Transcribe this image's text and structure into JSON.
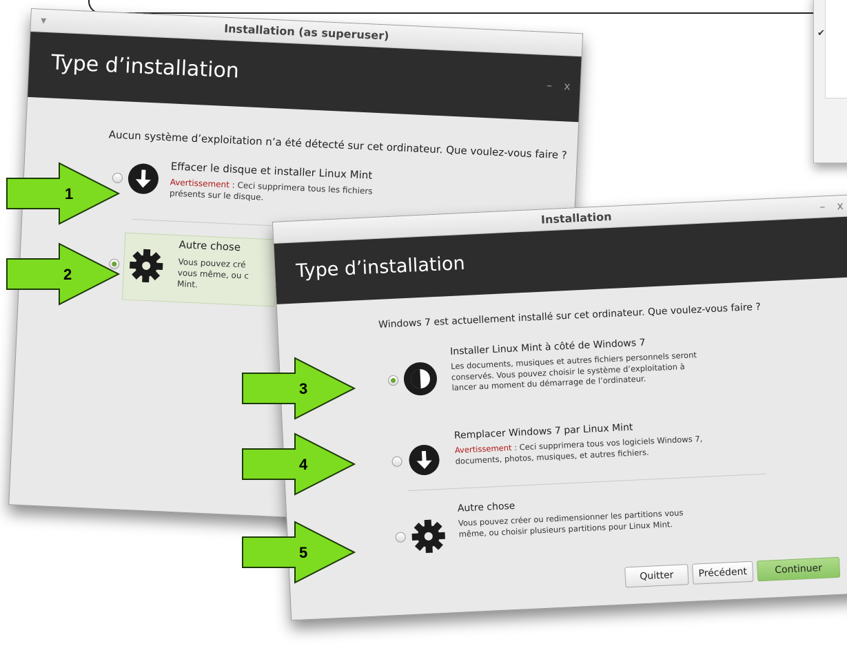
{
  "dialog_back": {
    "title": "Installation (as superuser)",
    "heading": "Type d’installation",
    "question": "Aucun système d’exploitation n’a été détecté sur cet ordinateur. Que voulez-vous faire ?",
    "options": [
      {
        "title": "Effacer le disque et installer Linux Mint",
        "warning_label": "Avertissement :",
        "warning_text": "Ceci supprimera tous les fichiers présents sur le disque.",
        "selected": false,
        "icon": "download-arrow-icon"
      },
      {
        "title": "Autre chose",
        "desc": "Vous pouvez cré… vous même, ou c… Mint.",
        "desc_lines": [
          "Vous pouvez cré",
          "vous même, ou c",
          "Mint."
        ],
        "selected": true,
        "icon": "gear-icon"
      }
    ]
  },
  "dialog_front": {
    "title": "Installation",
    "heading": "Type d’installation",
    "question": "Windows 7 est actuellement installé sur cet ordinateur. Que voulez-vous faire ?",
    "options": [
      {
        "title": "Installer Linux Mint à côté de Windows 7",
        "desc": "Les documents, musiques et autres fichiers personnels seront conservés. Vous pouvez choisir le système d’exploitation à lancer au moment du démarrage de l’ordinateur.",
        "selected": true,
        "icon": "half-circle-icon"
      },
      {
        "title": "Remplacer Windows 7 par Linux Mint",
        "warning_label": "Avertissement :",
        "warning_text": "Ceci supprimera tous vos logiciels Windows 7, documents, photos, musiques, et autres fichiers.",
        "selected": false,
        "icon": "download-arrow-icon"
      },
      {
        "title": "Autre chose",
        "desc": "Vous pouvez créer ou redimensionner les partitions vous même, ou choisir plusieurs partitions pour Linux Mint.",
        "selected": false,
        "icon": "gear-icon"
      }
    ],
    "buttons": {
      "quit": "Quitter",
      "back": "Précédent",
      "continue": "Continuer"
    }
  },
  "arrows": [
    "1",
    "2",
    "3",
    "4",
    "5"
  ],
  "colors": {
    "arrow_fill": "#7ddc1f",
    "header_band": "#2d2d2d",
    "warning": "#b01515",
    "continue_button": "#8cc665"
  }
}
